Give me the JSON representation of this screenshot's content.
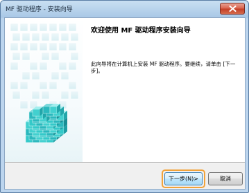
{
  "window": {
    "title": "MF 驱动程序 - 安装向导"
  },
  "main": {
    "heading": "欢迎使用 MF 驱动程序安装向导",
    "description": "此向导将在计算机上安装 MF 驱动程序。要继续，请单击 [下一步]。"
  },
  "buttons": {
    "next_label": "下一步(N)>",
    "cancel_label": "取消"
  },
  "colors": {
    "accent_cube": "#2fc6c6",
    "highlight": "#f2a33a"
  },
  "icons": {
    "close": "close-icon",
    "banner": "cube-graphic"
  }
}
